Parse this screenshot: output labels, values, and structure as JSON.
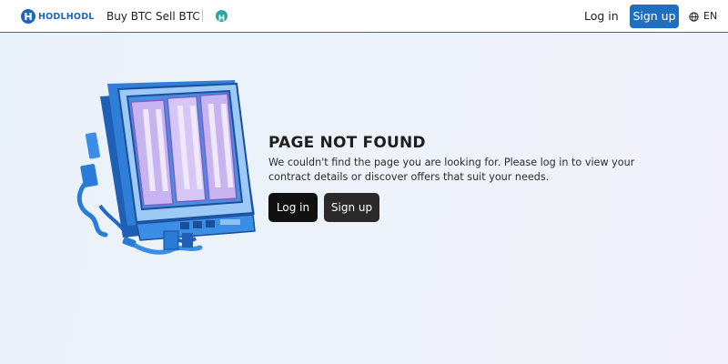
{
  "header": {
    "logo_text": "HODLHODL",
    "nav": [
      "Buy BTC",
      "Sell BTC"
    ],
    "login_label": "Log in",
    "signup_label": "Sign up",
    "language": "EN"
  },
  "error": {
    "title": "PAGE NOT FOUND",
    "message": "We couldn't find the page you are looking for. Please log in to view your contract details or discover offers that suit your needs.",
    "login_button": "Log in",
    "signup_button": "Sign up"
  },
  "colors": {
    "brand_blue": "#1f6fc1",
    "teal_coin": "#2aa6a0",
    "primary_button": "#111111"
  }
}
